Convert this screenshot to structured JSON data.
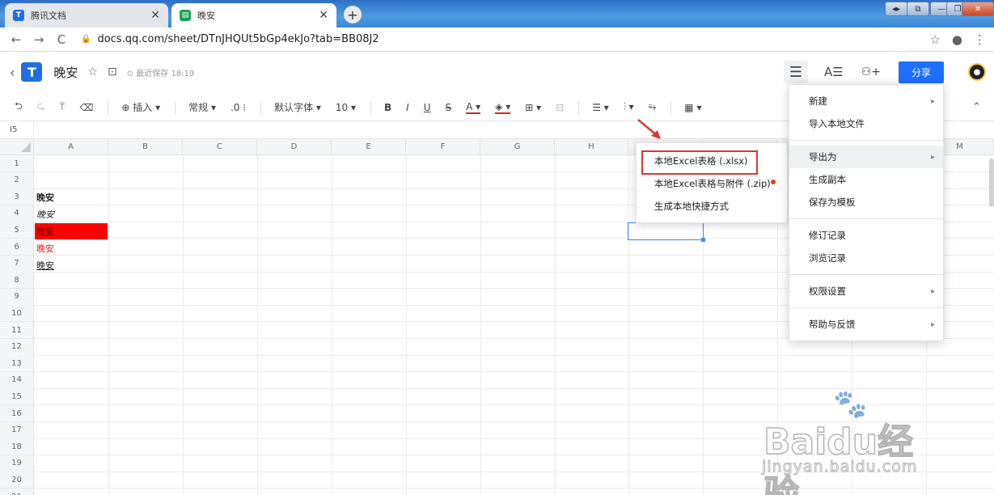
{
  "browser": {
    "tabs": [
      {
        "title": "腾讯文档",
        "close": "✕"
      },
      {
        "title": "晚安",
        "close": "✕"
      }
    ],
    "new_tab": "+",
    "window_controls": [
      "◂▸",
      "⧉",
      "—",
      "❐",
      "✕"
    ],
    "url": "docs.qq.com/sheet/DTnJHQUt5bGp4ekJo?tab=BB08J2",
    "nav": {
      "back": "←",
      "forward": "→",
      "reload": "C"
    },
    "right_icons": [
      "☆",
      "●",
      "⋮"
    ]
  },
  "header": {
    "back": "‹",
    "logo": "T",
    "title": "晚安",
    "star_icon": "☆",
    "move_icon": "⊡",
    "save_status": "最近保存 18:19",
    "menu_icon": "☰",
    "font_icon": "A☰",
    "add_user_icon": "⚇+",
    "share_label": "分享",
    "avatar": "●"
  },
  "toolbar": {
    "undo": "⮌",
    "redo": "⮎",
    "format_painter": "⍑",
    "eraser": "⌫",
    "insert": "⊕ 插入 ▾",
    "number_format": "常规 ▾",
    "decimal": ".0 ⁝",
    "font": "默认字体 ▾",
    "font_size": "10 ▾",
    "bold": "B",
    "italic": "I",
    "underline": "U",
    "strike": "S",
    "text_color": "A ▾",
    "fill_color": "◈ ▾",
    "border": "⊞ ▾",
    "merge": "⊟",
    "align_h": "☰ ▾",
    "align_v": "⫶ ▾",
    "wrap": "⥱",
    "chart": "▦ ▾",
    "collapse": "⌃"
  },
  "formula_bar": {
    "cell_ref": "I5"
  },
  "grid": {
    "columns": [
      "A",
      "B",
      "C",
      "D",
      "E",
      "F",
      "G",
      "H",
      "I",
      "J",
      "K",
      "L",
      "M"
    ],
    "rows": [
      "1",
      "2",
      "3",
      "4",
      "5",
      "6",
      "7",
      "8",
      "9",
      "10",
      "11",
      "12",
      "13",
      "14",
      "15",
      "16",
      "17",
      "18",
      "19",
      "20",
      "21"
    ],
    "cells": {
      "A3": "晚安",
      "A4": "晚安",
      "A5": "晚安",
      "A6": "晚安",
      "A7": "晚安"
    },
    "colors": {
      "fill_red": "#ff0000",
      "text_red": "#e02020",
      "selection": "#4a86e8"
    }
  },
  "submenu": {
    "items": [
      {
        "label": "本地Excel表格 (.xlsx)"
      },
      {
        "label": "本地Excel表格与附件 (.zip)"
      },
      {
        "label": "生成本地快捷方式"
      }
    ]
  },
  "main_menu": {
    "items": [
      {
        "label": "新建",
        "chevron": "▸"
      },
      {
        "label": "导入本地文件"
      },
      {
        "label": "导出为",
        "chevron": "▸"
      },
      {
        "label": "生成副本"
      },
      {
        "label": "保存为模板"
      },
      {
        "label": "修订记录"
      },
      {
        "label": "浏览记录"
      },
      {
        "label": "权限设置",
        "chevron": "▸"
      },
      {
        "label": "帮助与反馈",
        "chevron": "▸"
      }
    ]
  },
  "watermark": {
    "brand": "Baidu经验",
    "sub": "jingyan.baidu.com",
    "paw": "🐾"
  }
}
